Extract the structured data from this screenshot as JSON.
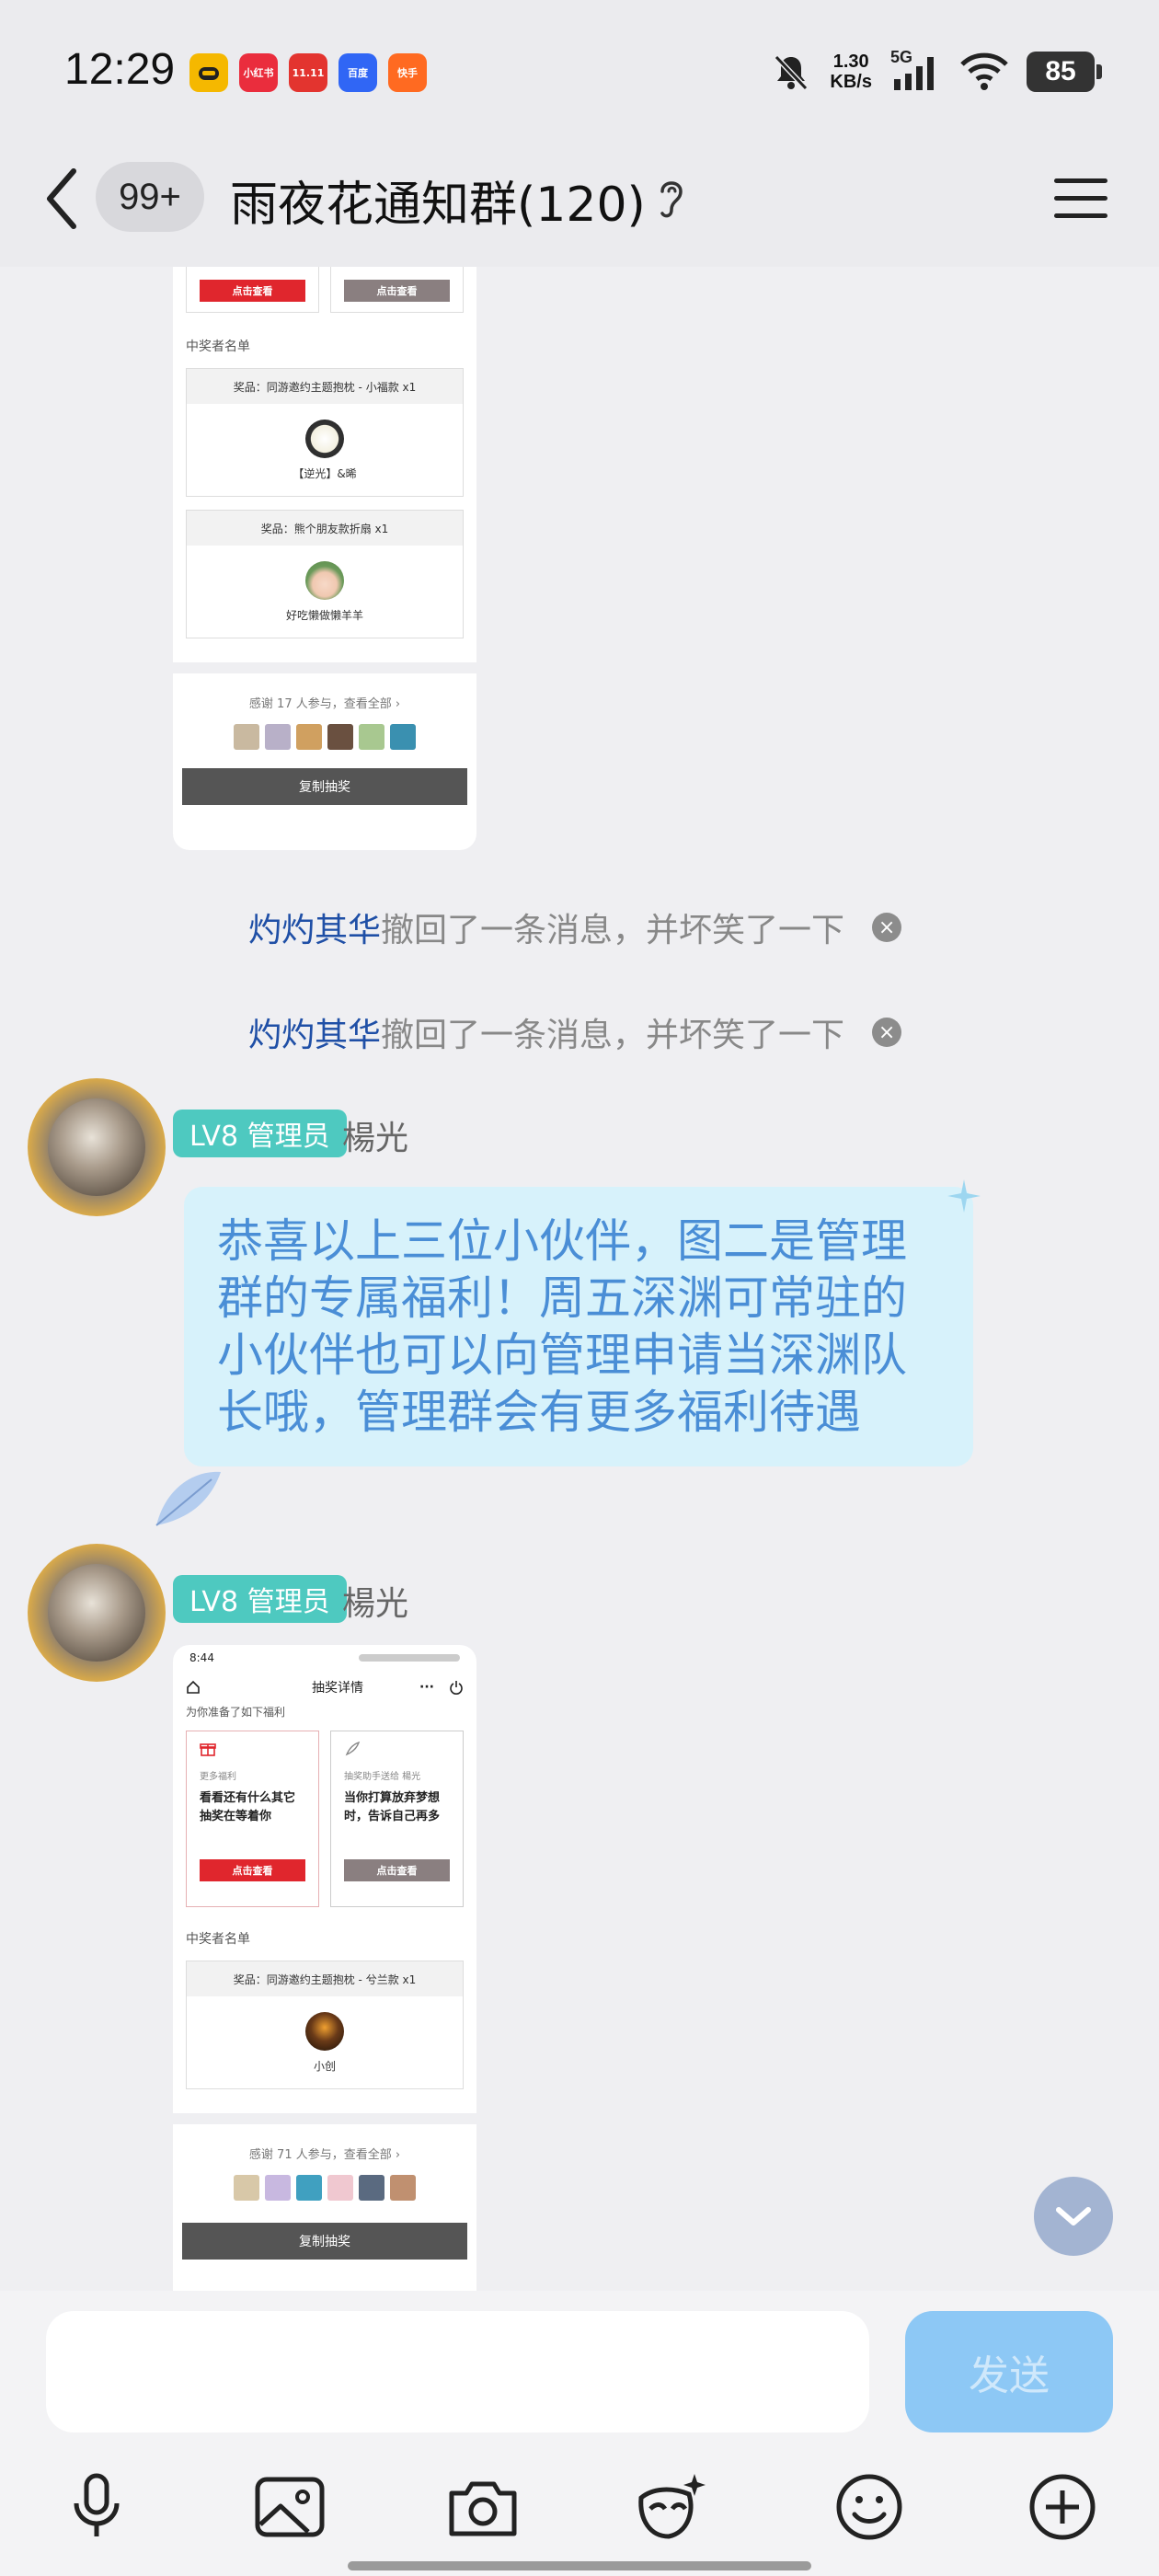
{
  "status": {
    "time": "12:29",
    "apps": [
      {
        "label": "",
        "color": "#f5b800"
      },
      {
        "label": "小红书",
        "color": "#ea2d3d"
      },
      {
        "label": "11.11",
        "color": "#e3342f"
      },
      {
        "label": "百度",
        "color": "#3066f5"
      },
      {
        "label": "快手",
        "color": "#ff6a21"
      }
    ],
    "speed_top": "1.30",
    "speed_unit": "KB/s",
    "network": "5G",
    "battery": "85"
  },
  "header": {
    "unread": "99+",
    "title": "雨夜花通知群(120)"
  },
  "shot1": {
    "btn_view": "点击查看",
    "winners_label": "中奖者名单",
    "prizes": [
      {
        "head": "奖品：同游邀约主题抱枕 - 小福款 x1",
        "winner": "【逆光】&晞"
      },
      {
        "head": "奖品：熊个朋友款折扇 x1",
        "winner": "好吃懒做懒羊羊"
      }
    ],
    "thanks": "感谢 17 人参与，查看全部 ›",
    "copy": "复制抽奖"
  },
  "recalls": [
    {
      "who": "灼灼其华",
      "text": "撤回了一条消息，并坏笑了一下"
    },
    {
      "who": "灼灼其华",
      "text": "撤回了一条消息，并坏笑了一下"
    }
  ],
  "messages": [
    {
      "level": "LV8 管理员",
      "name": "楊光",
      "text": "恭喜以上三位小伙伴，图二是管理群的专属福利！周五深渊可常驻的小伙伴也可以向管理申请当深渊队长哦，管理群会有更多福利待遇"
    },
    {
      "level": "LV8 管理员",
      "name": "楊光"
    }
  ],
  "shot2": {
    "time": "8:44",
    "title": "抽奖详情",
    "intro": "为你准备了如下福利",
    "card1_small": "更多福利",
    "card1_text": "看看还有什么其它抽奖在等着你",
    "card2_small": "抽奖助手送给 楊光",
    "card2_text": "当你打算放弃梦想时，告诉自己再多",
    "btn_view": "点击查看",
    "winners_label": "中奖者名单",
    "prize_head": "奖品：同游邀约主题抱枕 - 兮兰款 x1",
    "prize_winner": "小创",
    "thanks": "感谢 71 人参与，查看全部 ›",
    "copy": "复制抽奖"
  },
  "input": {
    "send": "发送"
  }
}
